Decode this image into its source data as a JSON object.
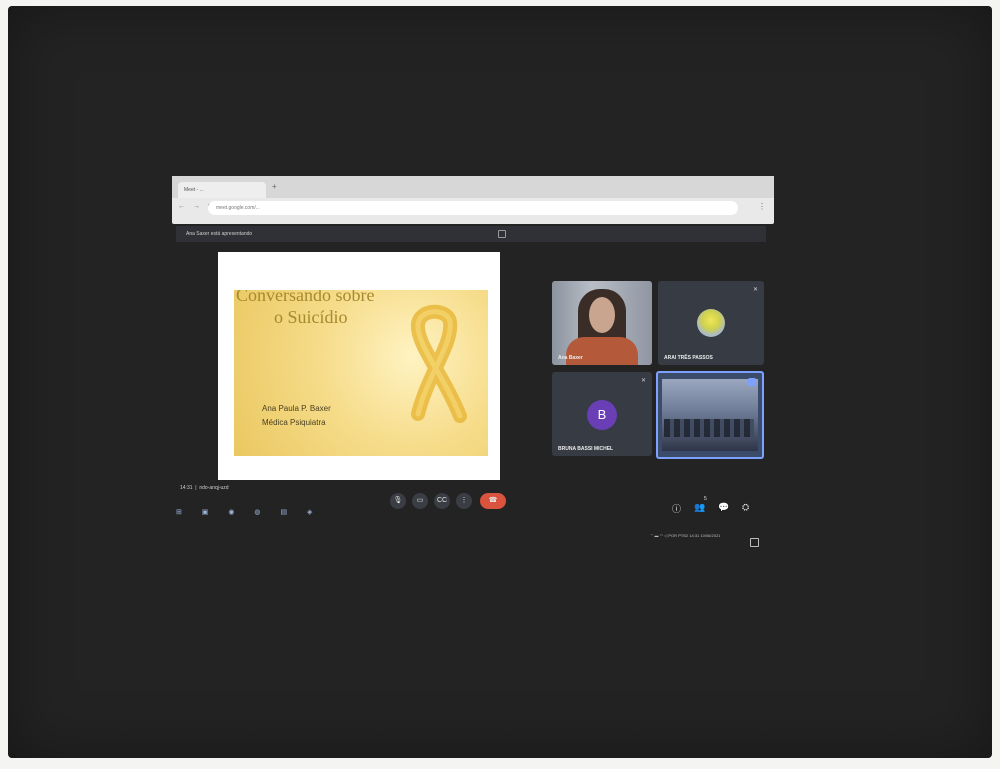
{
  "browser": {
    "tab_title": "Meet - ...",
    "new_tab_symbol": "+",
    "address": "meet.google.com/...",
    "nav_symbols": "← → ⟳",
    "menu_symbol": "⋮"
  },
  "meet": {
    "presenter_note": "Ana Saxer está apresentando",
    "meeting_time": "14:31",
    "meeting_code": "ndo-anqj-uzd"
  },
  "slide": {
    "title_line1": "Conversando sobre",
    "title_line2": "o Suicídio",
    "author_name": "Ana Paula P. Baxer",
    "author_role": "Médica Psiquiatra"
  },
  "participants": [
    {
      "name": "Ana Baxer"
    },
    {
      "name": "ARAI TRÊS PASSOS"
    },
    {
      "name": "BRUNA BASSI MICHEL",
      "avatar_letter": "B"
    },
    {
      "name": ""
    }
  ],
  "controls": {
    "mic": "🎙",
    "camera": "▭",
    "captions": "CC",
    "more": "⋮",
    "end_call": "☎",
    "info": "ⓘ",
    "people": "👥",
    "chat": "💬",
    "activities": "⛭",
    "people_count": "5"
  },
  "taskbar": {
    "icons": "⊞ ▣ ◉ ◍ ▤ ◈",
    "tray": "⌃ ▬ ◠ ◁  POR  PTB2  14:31  10/06/2021"
  },
  "colors": {
    "end_call": "#d9533e",
    "active_speaker_border": "#7da1ff",
    "avatar_b": "#6a3fb5",
    "slide_title": "#a68a2f"
  }
}
